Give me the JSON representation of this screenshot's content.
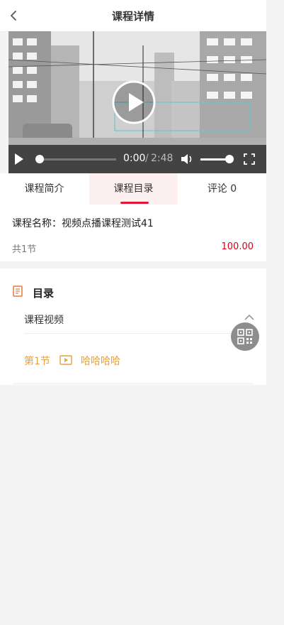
{
  "header": {
    "title": "课程详情"
  },
  "player": {
    "current_time": "0:00",
    "separator": "/",
    "duration": "2:48",
    "progress": 0.0,
    "volume": 0.85
  },
  "tabs": [
    {
      "label": "课程简介",
      "active": false
    },
    {
      "label": "课程目录",
      "active": true
    },
    {
      "label": "评论 0",
      "active": false
    }
  ],
  "course": {
    "name": "课程名称：视频点播课程测试41",
    "lesson_count": "共1节",
    "price": "100.00"
  },
  "catalog": {
    "title": "目录",
    "section": "课程视频",
    "lessons": [
      {
        "number": "第1节",
        "title": "哈哈哈哈"
      }
    ]
  },
  "colors": {
    "accent": "#e0193a",
    "price": "#d0021b",
    "lesson": "#e8a13b"
  }
}
